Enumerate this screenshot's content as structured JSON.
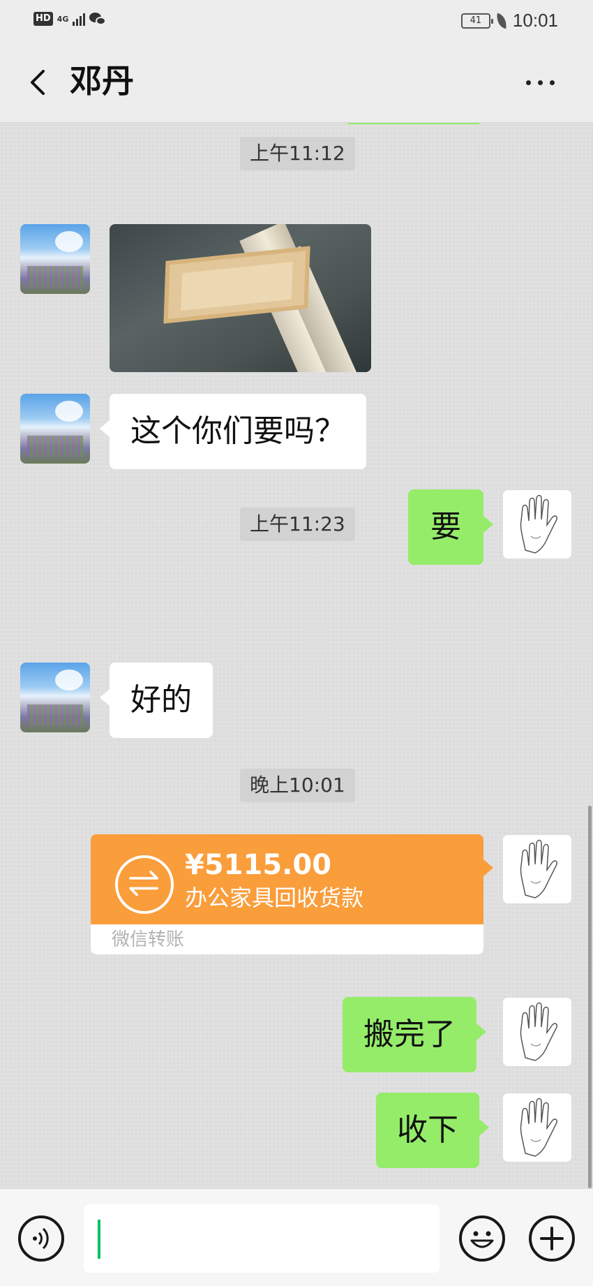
{
  "status_bar": {
    "hd": "HD",
    "network": "4G",
    "battery": "41",
    "time": "10:01"
  },
  "nav": {
    "title": "邓丹"
  },
  "messages": {
    "ts1": "上午11:12",
    "msg_question": "这个你们要吗？",
    "msg_yes": "要",
    "ts2": "上午11:23",
    "msg_ok": "好的",
    "ts3": "晚上10:01",
    "transfer": {
      "amount": "¥5115.00",
      "note": "办公家具回收货款",
      "label": "微信转账"
    },
    "msg_moved": "搬完了",
    "msg_accept": "收下"
  },
  "colors": {
    "sent_bubble": "#95ec69",
    "received_bubble": "#ffffff",
    "transfer_orange": "#fa9d3b",
    "cursor": "#07c160"
  },
  "icons": {
    "back": "back-arrow-icon",
    "more": "more-icon",
    "voice": "voice-icon",
    "emoji": "emoji-icon",
    "plus": "plus-icon",
    "transfer": "transfer-arrows-icon"
  }
}
